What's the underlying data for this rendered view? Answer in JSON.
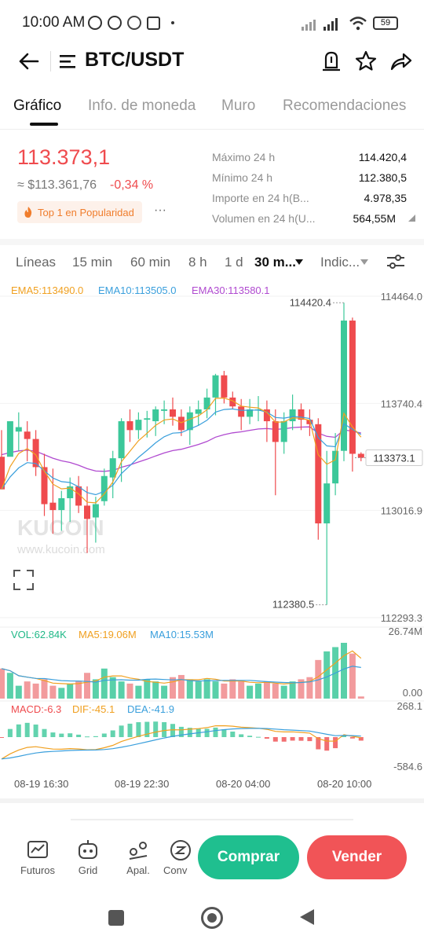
{
  "status_bar": {
    "time": "10:00 AM",
    "battery": "59"
  },
  "header": {
    "pair": "BTC/USDT"
  },
  "tabs": [
    {
      "label": "Gráfico"
    },
    {
      "label": "Info. de moneda"
    },
    {
      "label": "Muro"
    },
    {
      "label": "Recomendaciones"
    }
  ],
  "ticker": {
    "price": "113.373,1",
    "approx": "≈ $113.361,76",
    "change": "-0,34 %",
    "badge": "Top 1 en Popularidad",
    "more": "···",
    "stats": [
      {
        "label": "Máximo 24 h",
        "value": "114.420,4"
      },
      {
        "label": "Mínimo 24 h",
        "value": "112.380,5"
      },
      {
        "label": "Importe en 24 h(B...",
        "value": "4.978,35"
      },
      {
        "label": "Volumen en 24 h(U...",
        "value": "564,55M"
      }
    ]
  },
  "chart_toolbar": {
    "items": [
      "Líneas",
      "15 min",
      "60 min",
      "8 h",
      "1 d",
      "30 m...",
      "Indic..."
    ],
    "active": "30 m..."
  },
  "colors": {
    "up": "#3cc89a",
    "down": "#ef4b4e",
    "ema5": "#f0a020",
    "ema10": "#3a9fdc",
    "ema30": "#b04ad0",
    "buy": "#1fbf8f",
    "sell": "#f15457"
  },
  "chart_data": {
    "type": "candlestick",
    "price_axis": [
      "114464.0",
      "113740.4",
      "113016.9",
      "112293.3"
    ],
    "price_range": [
      112293.3,
      114464.0
    ],
    "high_label": "114420.4",
    "low_label": "112380.5",
    "last_price": "113373.1",
    "legend": {
      "ema5": "EMA5:113490.0",
      "ema10": "EMA10:113505.0",
      "ema30": "EMA30:113580.1"
    },
    "watermark": {
      "logo": "KUCOIN",
      "url": "www.kucoin.com"
    },
    "time_labels": [
      "08-19 16:30",
      "08-19 22:30",
      "08-20 04:00",
      "08-20 10:00"
    ],
    "candles": [
      [
        113380,
        113560,
        113200,
        113160
      ],
      [
        113380,
        113550,
        113400,
        113620
      ],
      [
        113550,
        113680,
        113420,
        113580
      ],
      [
        113550,
        113620,
        113350,
        113500
      ],
      [
        113500,
        113560,
        113250,
        113310
      ],
      [
        113310,
        113400,
        112980,
        113060
      ],
      [
        113070,
        113300,
        112860,
        113020
      ],
      [
        113020,
        113150,
        112880,
        113100
      ],
      [
        113100,
        113240,
        112940,
        113180
      ],
      [
        113180,
        113250,
        113000,
        113050
      ],
      [
        113050,
        113180,
        112730,
        112960
      ],
      [
        112970,
        113110,
        112800,
        113060
      ],
      [
        113080,
        113300,
        113050,
        113250
      ],
      [
        113240,
        113420,
        113100,
        113370
      ],
      [
        113370,
        113640,
        113210,
        113620
      ],
      [
        113620,
        113700,
        113480,
        113560
      ],
      [
        113560,
        113680,
        113500,
        113630
      ],
      [
        113630,
        113690,
        113510,
        113640
      ],
      [
        113620,
        113720,
        113520,
        113700
      ],
      [
        113690,
        113760,
        113600,
        113700
      ],
      [
        113700,
        113780,
        113590,
        113650
      ],
      [
        113650,
        113700,
        113520,
        113560
      ],
      [
        113560,
        113720,
        113460,
        113680
      ],
      [
        113670,
        113760,
        113590,
        113700
      ],
      [
        113700,
        113840,
        113640,
        113780
      ],
      [
        113780,
        113940,
        113660,
        113930
      ],
      [
        113930,
        113960,
        113740,
        113780
      ],
      [
        113780,
        113820,
        113700,
        113720
      ],
      [
        113720,
        113770,
        113560,
        113650
      ],
      [
        113650,
        113770,
        113600,
        113700
      ],
      [
        113700,
        113790,
        113620,
        113700
      ],
      [
        113700,
        113760,
        113480,
        113620
      ],
      [
        113620,
        113700,
        113120,
        113480
      ],
      [
        113480,
        113680,
        113400,
        113620
      ],
      [
        113620,
        113800,
        113560,
        113700
      ],
      [
        113700,
        113740,
        113560,
        113630
      ],
      [
        113630,
        113700,
        113520,
        113600
      ],
      [
        113600,
        113640,
        112820,
        112930
      ],
      [
        112930,
        113420,
        112380,
        113200
      ],
      [
        113200,
        113540,
        113120,
        113420
      ],
      [
        113420,
        114420,
        113350,
        114300
      ],
      [
        114300,
        114320,
        113280,
        113400
      ],
      [
        113400,
        113410,
        113350,
        113373
      ]
    ],
    "volume": {
      "legend": {
        "vol": "VOL:62.84K",
        "ma5": "MA5:19.06M",
        "ma10": "MA10:15.53M"
      },
      "axis": [
        "26.74M",
        "0.00"
      ],
      "values": [
        14,
        12,
        6,
        8,
        7,
        9,
        6,
        5,
        7,
        8,
        12,
        9,
        14,
        10,
        8,
        7,
        6,
        9,
        8,
        6,
        10,
        11,
        9,
        8,
        9,
        8,
        7,
        9,
        8,
        6,
        7,
        8,
        7,
        6,
        8,
        9,
        10,
        18,
        22,
        24,
        26,
        21,
        1
      ]
    },
    "macd": {
      "legend": {
        "macd": "MACD:-6.3",
        "dif": "DIF:-45.1",
        "dea": "DEA:-41.9"
      },
      "axis": [
        "268.1",
        "-584.6"
      ]
    }
  },
  "bottom_nav": [
    {
      "label": "Futuros"
    },
    {
      "label": "Grid"
    },
    {
      "label": "Apal."
    },
    {
      "label": "Conv"
    }
  ],
  "actions": {
    "buy": "Comprar",
    "sell": "Vender"
  }
}
